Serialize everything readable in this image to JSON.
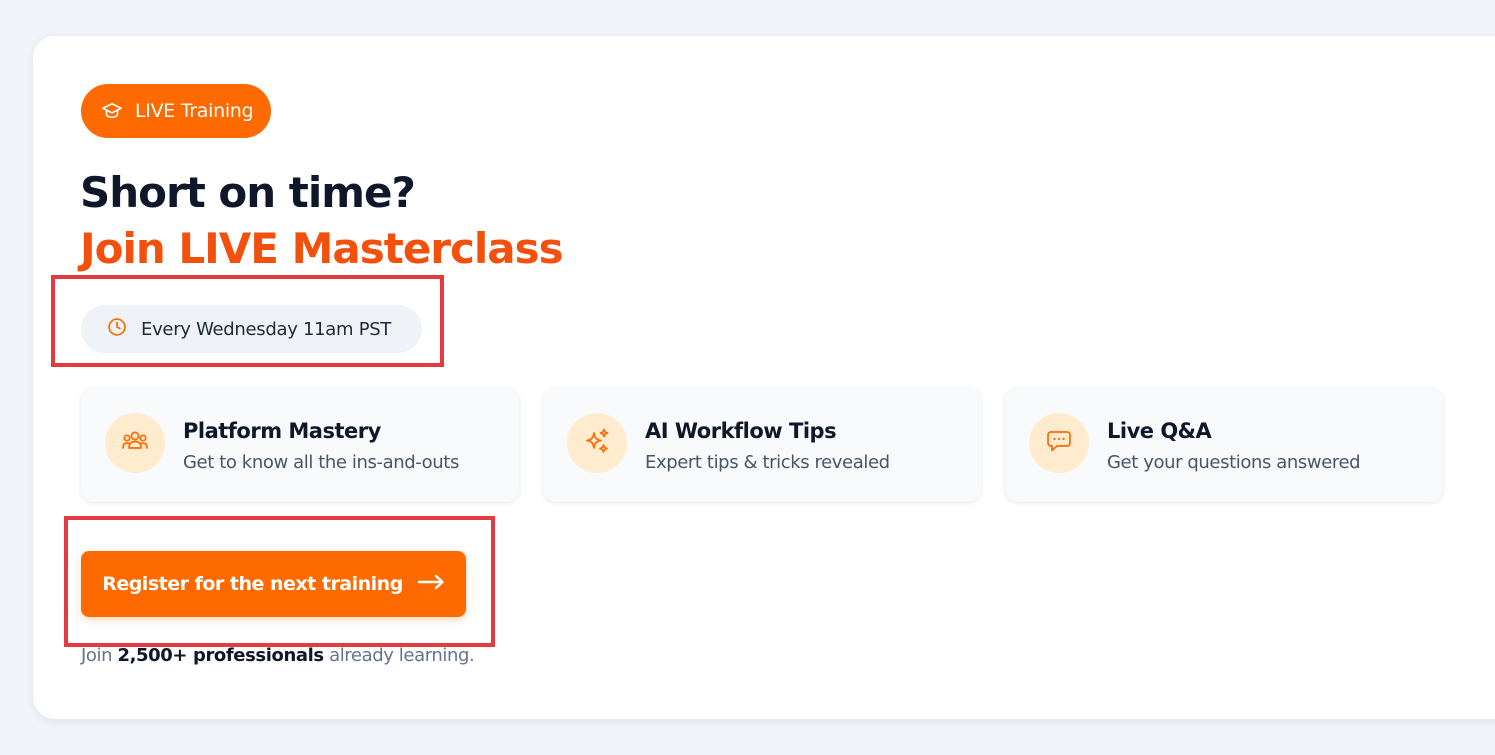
{
  "badge": {
    "label": "LIVE Training",
    "icon": "graduation-cap-icon"
  },
  "headline": {
    "line1": "Short on time?",
    "line2": "Join LIVE Masterclass"
  },
  "schedule": {
    "icon": "clock-icon",
    "text": "Every Wednesday 11am PST"
  },
  "features": [
    {
      "icon": "users-icon",
      "title": "Platform Mastery",
      "description": "Get to know all the ins-and-outs"
    },
    {
      "icon": "sparkles-icon",
      "title": "AI Workflow Tips",
      "description": "Expert tips & tricks revealed"
    },
    {
      "icon": "chat-bubble-icon",
      "title": "Live Q&A",
      "description": "Get your questions answered"
    }
  ],
  "cta": {
    "label": "Register for the next training",
    "icon": "arrow-right-icon"
  },
  "social_proof": {
    "prefix": "Join",
    "count": "2,500+ professionals",
    "suffix": "already learning."
  },
  "colors": {
    "brand_orange": "#ff6a00",
    "headline_orange": "#f2500c",
    "highlight_red": "#e33b3f",
    "icon_circle": "#ffeccf"
  }
}
